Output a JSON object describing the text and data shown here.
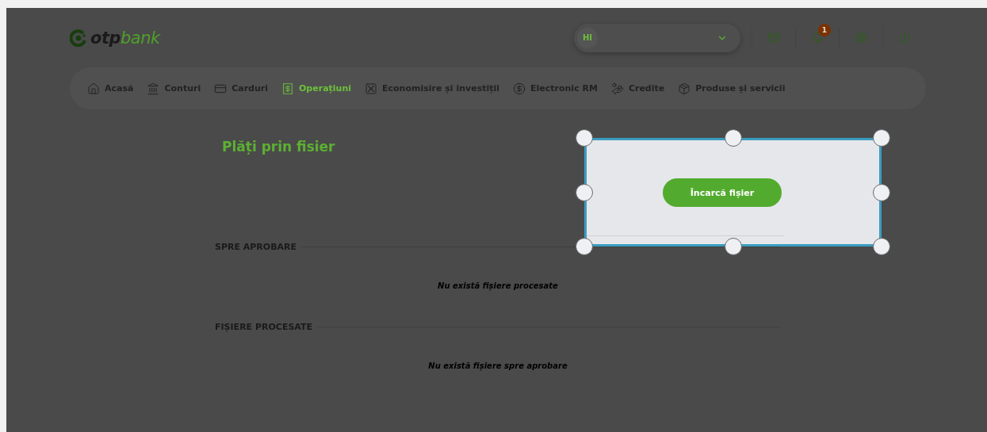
{
  "logo": {
    "text": "**otp**bank"
  },
  "header": {
    "user_initials": "HI",
    "notification_count": "1"
  },
  "nav": [
    {
      "label": "Acasă",
      "selected": false
    },
    {
      "label": "Conturi",
      "selected": false
    },
    {
      "label": "Carduri",
      "selected": false
    },
    {
      "label": "Operațiuni",
      "selected": true
    },
    {
      "label": "Economisire și investiții",
      "selected": false
    },
    {
      "label": "Electronic RM",
      "selected": false
    },
    {
      "label": "Credite",
      "selected": false
    },
    {
      "label": "Produse și servicii",
      "selected": false
    }
  ],
  "page_title": "Plăți prin fisier",
  "sections": [
    {
      "title": "SPRE APROBARE",
      "empty_message": "Nu există fișiere procesate"
    },
    {
      "title": "FIȘIERE PROCESATE",
      "empty_message": "Nu există fișiere spre aprobare"
    }
  ],
  "selection": {
    "button": "Încarcă fișier"
  }
}
